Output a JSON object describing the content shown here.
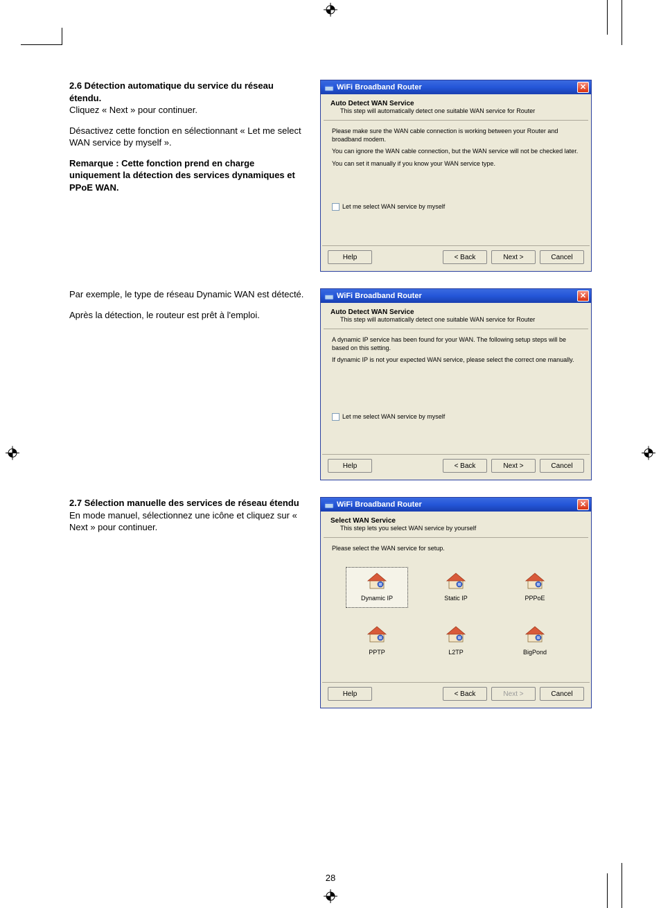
{
  "page_number": "28",
  "sections": {
    "s1": {
      "heading": "2.6 Détection automatique du service du réseau étendu.",
      "line1": "Cliquez « Next » pour continuer.",
      "para2": "Désactivez cette fonction en sélectionnant « Let me select WAN service by myself ».",
      "para3": "Remarque : Cette fonction prend en charge uniquement la détection des services dynamiques et PPoE WAN."
    },
    "s2": {
      "line1": "Par exemple, le type de réseau Dynamic WAN est détecté.",
      "line2": "Après la détection, le routeur est prêt à l'emploi."
    },
    "s3": {
      "heading": "2.7 Sélection manuelle des services de réseau étendu",
      "line1": "En mode manuel, sélectionnez une icône et cliquez sur « Next » pour continuer."
    }
  },
  "dialogs": {
    "d1": {
      "title": "WiFi Broadband Router",
      "header_title": "Auto Detect WAN Service",
      "header_sub": "This step will automatically detect one suitable WAN service for Router",
      "body": {
        "p1": "Please make sure the WAN cable connection is working between your Router and broadband modem.",
        "p2": "You can ignore the WAN cable connection, but the WAN service will not be checked later.",
        "p3": "You can set it manually if you know your WAN service type."
      },
      "checkbox_label": "Let me select WAN service by myself",
      "buttons": {
        "help": "Help",
        "back": "< Back",
        "next": "Next >",
        "cancel": "Cancel"
      }
    },
    "d2": {
      "title": "WiFi Broadband Router",
      "header_title": "Auto Detect WAN Service",
      "header_sub": "This step will automatically detect one suitable WAN service for Router",
      "body": {
        "p1": "A dynamic IP service has been found for your WAN. The following setup steps will be based on this setting.",
        "p2": "If dynamic IP is not your expected WAN service, please select the correct one manually."
      },
      "checkbox_label": "Let me select WAN service by myself",
      "buttons": {
        "help": "Help",
        "back": "< Back",
        "next": "Next >",
        "cancel": "Cancel"
      }
    },
    "d3": {
      "title": "WiFi Broadband Router",
      "header_title": "Select WAN Service",
      "header_sub": "This step lets you select WAN service by yourself",
      "prompt": "Please select the WAN service for setup.",
      "services": [
        {
          "label": "Dynamic IP"
        },
        {
          "label": "Static IP"
        },
        {
          "label": "PPPoE"
        },
        {
          "label": "PPTP"
        },
        {
          "label": "L2TP"
        },
        {
          "label": "BigPond"
        }
      ],
      "buttons": {
        "help": "Help",
        "back": "< Back",
        "next": "Next >",
        "cancel": "Cancel"
      }
    }
  }
}
